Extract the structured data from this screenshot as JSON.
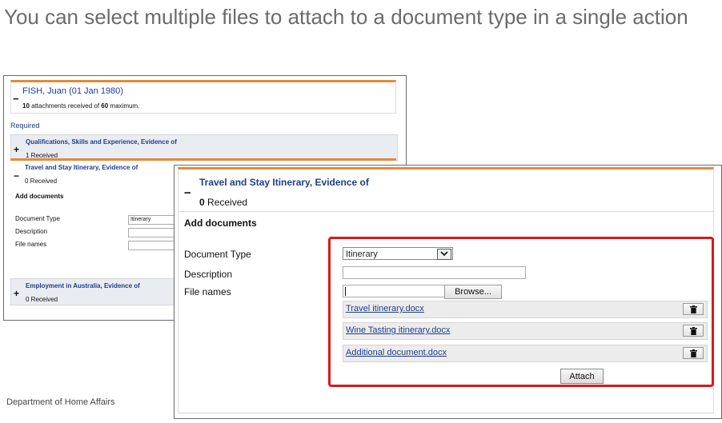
{
  "heading": "You can select multiple files to attach to a document type in a single action",
  "footer": "Department of Home Affairs",
  "background_screen": {
    "person_name": "FISH, Juan (01 Jan 1980)",
    "attachments_count": "10",
    "attachments_mid": " attachments received of ",
    "attachments_max": "60",
    "attachments_end": " maximum.",
    "required_label": "Required",
    "sections": [
      {
        "title": "Qualifications, Skills and Experience, Evidence of",
        "received": "1 Received",
        "sign": "+"
      },
      {
        "title": "Travel and Stay Itinerary, Evidence of",
        "received": "0 Received",
        "sign": "−"
      },
      {
        "title": "Employment in Australia, Evidence of",
        "received": "0 Received",
        "sign": "+"
      }
    ],
    "add_documents": "Add documents",
    "document_type_label": "Document Type",
    "description_label": "Description",
    "file_names_label": "File names",
    "document_type_value": "Itinerary"
  },
  "foreground_screen": {
    "section_title": "Travel and Stay Itinerary, Evidence of",
    "received_count": "0",
    "received_label": " Received",
    "add_documents": "Add documents",
    "document_type_label": "Document Type",
    "description_label": "Description",
    "file_names_label": "File names",
    "document_type_value": "Itinerary",
    "browse_label": "Browse...",
    "files": [
      "Travel itinerary.docx",
      "Wine Tasting itinerary.docx",
      "Additional document.docx"
    ],
    "attach_label": "Attach",
    "highlight_color": "#d7191f",
    "accent_color": "#e08a3c",
    "link_color": "#1d3e8a"
  }
}
